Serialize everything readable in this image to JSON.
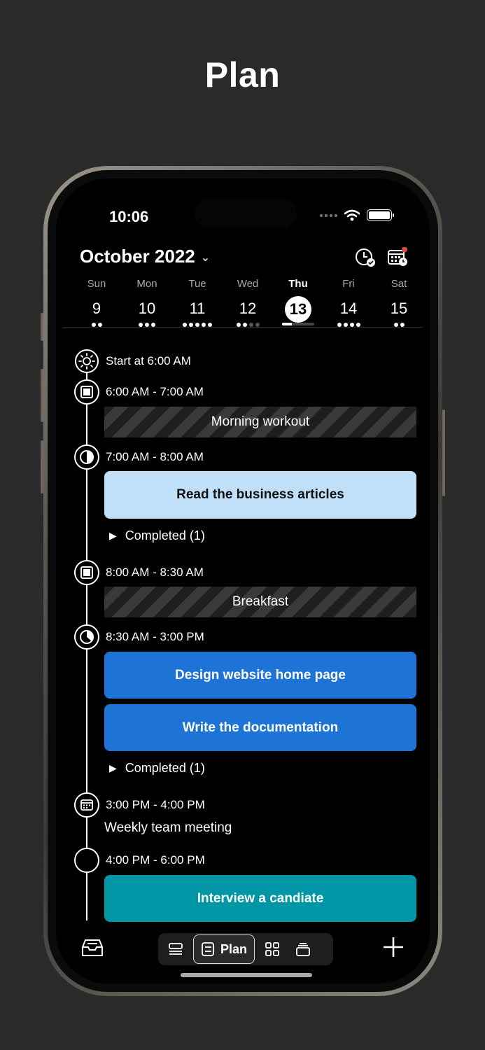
{
  "page": {
    "title": "Plan"
  },
  "status_bar": {
    "time": "10:06",
    "icons": [
      "signal-dots",
      "wifi-icon",
      "battery-icon"
    ]
  },
  "header": {
    "month": "October 2022",
    "icons": [
      "clock-check-icon",
      "calendar-clock-icon"
    ],
    "notification_color": "#e0473f"
  },
  "week": {
    "days": [
      {
        "name": "Sun",
        "num": "9",
        "dots": 2,
        "dim": 0
      },
      {
        "name": "Mon",
        "num": "10",
        "dots": 3,
        "dim": 0
      },
      {
        "name": "Tue",
        "num": "11",
        "dots": 5,
        "dim": 0
      },
      {
        "name": "Wed",
        "num": "12",
        "dots": 2,
        "dim": 2
      },
      {
        "name": "Thu",
        "num": "13",
        "today": true,
        "progress": 0.3
      },
      {
        "name": "Fri",
        "num": "14",
        "dots": 4,
        "dim": 0
      },
      {
        "name": "Sat",
        "num": "15",
        "dots": 2,
        "dim": 0
      }
    ]
  },
  "timeline": {
    "start": "Start at 6:00 AM",
    "slots": [
      {
        "time": "6:00 AM - 7:00 AM",
        "icon": "focus-icon"
      },
      {
        "time": "7:00 AM - 8:00 AM",
        "icon": "half-moon-icon"
      },
      {
        "time": "8:00 AM - 8:30 AM",
        "icon": "focus-icon"
      },
      {
        "time": "8:30 AM - 3:00 PM",
        "icon": "pie-progress-icon"
      },
      {
        "time": "3:00 PM - 4:00 PM",
        "icon": "calendar-icon"
      },
      {
        "time": "4:00 PM - 6:00 PM",
        "icon": "empty-circle-icon"
      }
    ],
    "blocks": {
      "morning_workout": "Morning workout",
      "read_articles": "Read the business articles",
      "breakfast": "Breakfast",
      "design_website": "Design website home page",
      "write_docs": "Write the documentation",
      "interview": "Interview a candiate"
    },
    "completed_1": "Completed (1)",
    "completed_2": "Completed (1)",
    "meeting": "Weekly team meeting",
    "colors": {
      "light_blue": "#bfe0f8",
      "blue": "#1e74d6",
      "teal": "#0096a5"
    }
  },
  "tabbar": {
    "active_label": "Plan",
    "icons": [
      "inbox-icon",
      "list-view-icon",
      "plan-view-icon",
      "grid-view-icon",
      "stack-view-icon",
      "plus-icon"
    ]
  }
}
